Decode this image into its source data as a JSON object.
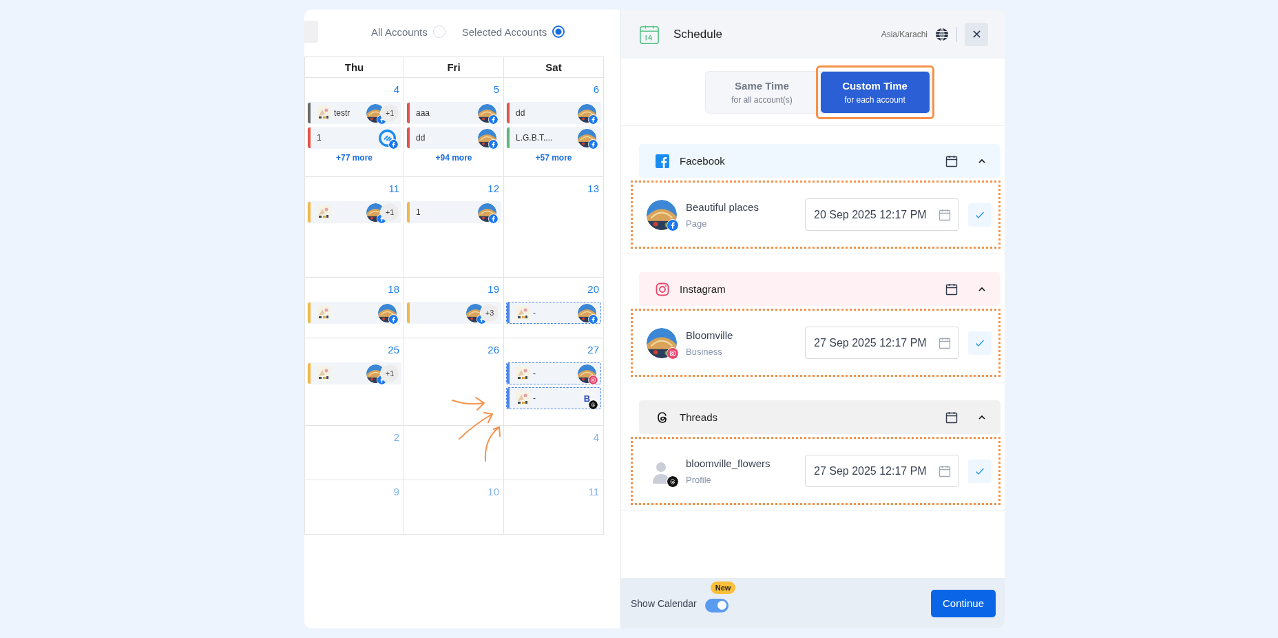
{
  "filter": {
    "options": [
      {
        "label": "All Accounts",
        "selected": false
      },
      {
        "label": "Selected Accounts",
        "selected": true
      }
    ]
  },
  "calendar": {
    "days": [
      "Thu",
      "Fri",
      "Sat"
    ],
    "weeks": [
      {
        "cells": [
          {
            "date": "4",
            "muted": false,
            "more": "+77 more",
            "events": [
              {
                "color": "#6b6b6b",
                "thumbnail": true,
                "text": "testr",
                "badge": {
                  "kind": "facebook"
                },
                "extra": "+1",
                "dashed": false
              },
              {
                "color": "#e5534b",
                "thumbnail": false,
                "text": "1",
                "avatar": {
                  "kind": "logo"
                },
                "badge": {
                  "kind": "facebook"
                },
                "dashed": false
              }
            ]
          },
          {
            "date": "5",
            "muted": false,
            "more": "+94 more",
            "events": [
              {
                "color": "#e5534b",
                "thumbnail": false,
                "text": "aaa",
                "badge": {
                  "kind": "facebook"
                },
                "dashed": false
              },
              {
                "color": "#e5534b",
                "thumbnail": false,
                "text": "dd",
                "badge": {
                  "kind": "facebook"
                },
                "dashed": false
              }
            ]
          },
          {
            "date": "6",
            "muted": false,
            "more": "+57 more",
            "events": [
              {
                "color": "#e5534b",
                "thumbnail": false,
                "text": "dd",
                "badge": {
                  "kind": "facebook"
                },
                "dashed": false
              },
              {
                "color": "#5fb87a",
                "thumbnail": false,
                "text": "L.G.B.T....",
                "badge": {
                  "kind": "facebook"
                },
                "dashed": false
              }
            ]
          }
        ]
      },
      {
        "cells": [
          {
            "date": "11",
            "muted": false,
            "events": [
              {
                "color": "#f0b94a",
                "thumbnail": true,
                "badge": {
                  "kind": "facebook"
                },
                "extra": "+1",
                "dashed": false
              }
            ]
          },
          {
            "date": "12",
            "muted": false,
            "events": [
              {
                "color": "#f0b94a",
                "thumbnail": false,
                "text": "1",
                "badge": {
                  "kind": "facebook"
                },
                "dashed": false
              }
            ]
          },
          {
            "date": "13",
            "muted": false
          }
        ]
      },
      {
        "cells": [
          {
            "date": "18",
            "muted": false,
            "events": [
              {
                "color": "#f0b94a",
                "thumbnail": true,
                "badge": {
                  "kind": "facebook"
                },
                "dashed": false
              }
            ]
          },
          {
            "date": "19",
            "muted": false,
            "events": [
              {
                "color": "#f0b94a",
                "thumbnail": false,
                "badge": {
                  "kind": "facebook"
                },
                "extra": "+3",
                "dashed": false
              }
            ]
          },
          {
            "date": "20",
            "muted": false,
            "events": [
              {
                "color": "#4b86f0",
                "thumbnail": true,
                "text": "-",
                "badge": {
                  "kind": "facebook"
                },
                "dashed": true
              }
            ]
          }
        ]
      },
      {
        "cells": [
          {
            "date": "25",
            "muted": false,
            "events": [
              {
                "color": "#f0b94a",
                "thumbnail": true,
                "badge": {
                  "kind": "facebook"
                },
                "extra": "+1",
                "dashed": false
              }
            ]
          },
          {
            "date": "26",
            "muted": false
          },
          {
            "date": "27",
            "muted": false,
            "events": [
              {
                "color": "#4b86f0",
                "thumbnail": true,
                "text": "-",
                "badge": {
                  "kind": "instagram"
                },
                "dashed": true
              },
              {
                "color": "#4b86f0",
                "thumbnail": true,
                "text": "-",
                "avatar": {
                  "kind": "letter",
                  "letter": "B"
                },
                "badge": {
                  "kind": "threads"
                },
                "dashed": true
              }
            ]
          }
        ]
      },
      {
        "cells": [
          {
            "date": "2",
            "muted": true
          },
          {},
          {
            "date": "4",
            "muted": true
          }
        ]
      },
      {
        "cells": [
          {
            "date": "9",
            "muted": true
          },
          {
            "date": "10",
            "muted": true
          },
          {
            "date": "11",
            "muted": true
          }
        ]
      }
    ]
  },
  "schedule": {
    "title": "Schedule",
    "timezone": "Asia/Karachi",
    "modes": [
      {
        "title": "Same Time",
        "subtitle": "for all account(s)",
        "selected": false,
        "highlighted": false
      },
      {
        "title": "Custom Time",
        "subtitle": "for each account",
        "selected": true,
        "highlighted": true
      }
    ],
    "groups": [
      {
        "kind": "facebook",
        "name": "Facebook",
        "expanded": true,
        "accounts": [
          {
            "name": "Beautiful places",
            "type": "Page",
            "datetime": "20 Sep 2025 12:17 PM",
            "checked": true,
            "highlighted": true
          }
        ]
      },
      {
        "kind": "instagram",
        "name": "Instagram",
        "expanded": true,
        "accounts": [
          {
            "name": "Bloomville",
            "type": "Business",
            "datetime": "27 Sep 2025 12:17 PM",
            "checked": true,
            "highlighted": true
          }
        ]
      },
      {
        "kind": "threads",
        "name": "Threads",
        "expanded": true,
        "accounts": [
          {
            "name": "bloomville_flowers",
            "type": "Profile",
            "datetime": "27 Sep 2025 12:17 PM",
            "avatar": {
              "kind": "silhouette"
            },
            "checked": true,
            "highlighted": true
          }
        ]
      }
    ]
  },
  "footer": {
    "toggle_label": "Show Calendar",
    "toggle_on": true,
    "badge": "New",
    "button": "Continue"
  }
}
